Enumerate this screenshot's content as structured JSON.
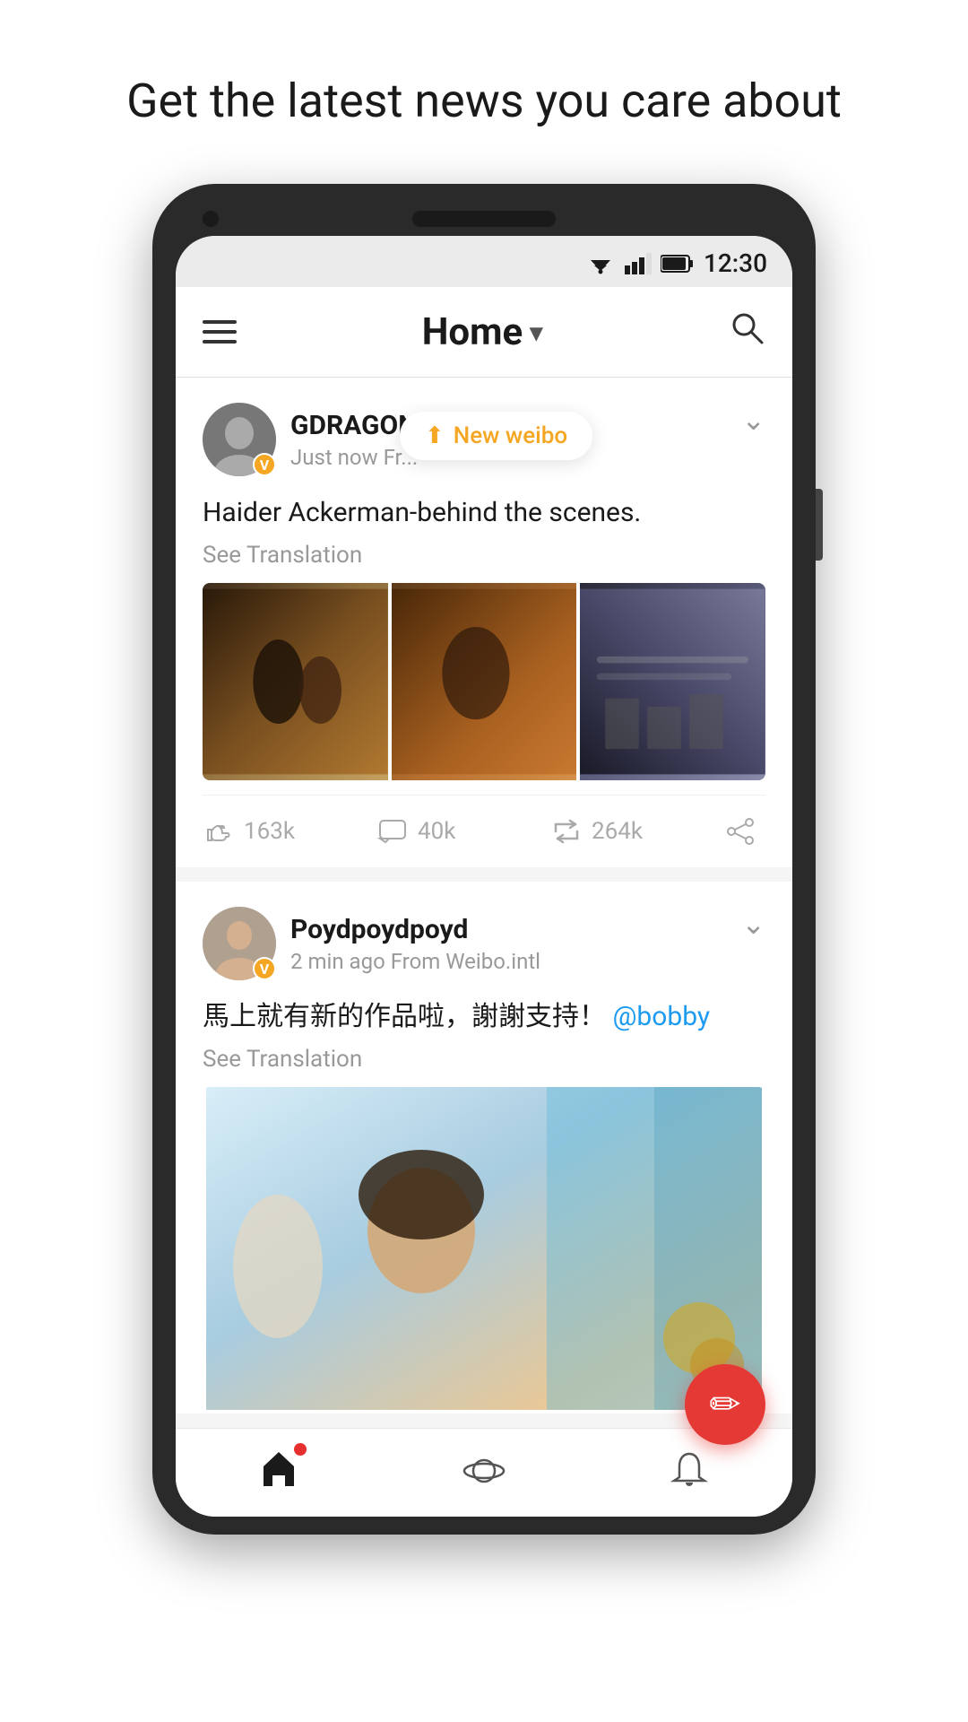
{
  "page": {
    "headline": "Get the latest news you care about"
  },
  "statusBar": {
    "time": "12:30"
  },
  "header": {
    "title": "Home",
    "menu_label": "Menu",
    "search_label": "Search"
  },
  "posts": [
    {
      "id": "post1",
      "user": {
        "name": "GDRAGON",
        "verified": true,
        "badge": "V"
      },
      "meta": "Just now  Fr...",
      "text": "Haider Ackerman-behind the scenes.",
      "see_translation": "See Translation",
      "likes": "163k",
      "comments": "40k",
      "reposts": "264k",
      "tooltip": {
        "arrow": "⬆",
        "text": "New weibo"
      },
      "images": [
        "img-gdragon1",
        "img-gdragon2",
        "img-gdragon3"
      ]
    },
    {
      "id": "post2",
      "user": {
        "name": "Poydpoydpoyd",
        "verified": true,
        "badge": "V"
      },
      "meta": "2 min ago  From Weibo.intl",
      "text": "馬上就有新的作品啦，謝謝支持！",
      "mention": "@bobby",
      "see_translation": "See Translation",
      "images": [
        "img-poyd1"
      ]
    }
  ],
  "fab": {
    "icon": "✏",
    "label": "compose"
  },
  "bottomNav": {
    "home": "home",
    "explore": "explore",
    "notifications": "notifications"
  }
}
